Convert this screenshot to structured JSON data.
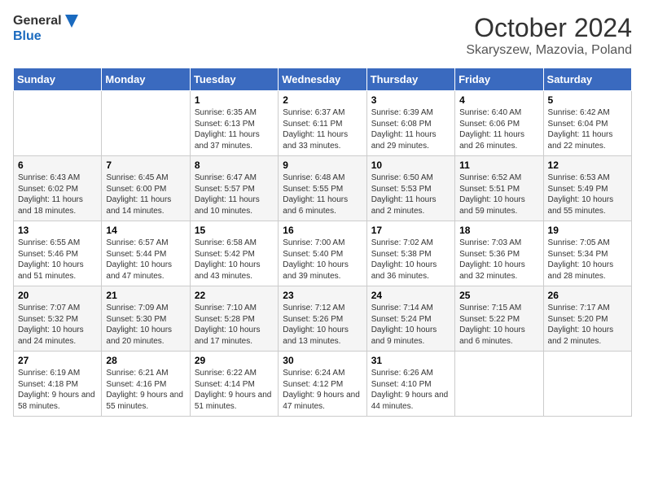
{
  "header": {
    "logo_general": "General",
    "logo_blue": "Blue",
    "month_title": "October 2024",
    "location": "Skaryszew, Mazovia, Poland"
  },
  "weekdays": [
    "Sunday",
    "Monday",
    "Tuesday",
    "Wednesday",
    "Thursday",
    "Friday",
    "Saturday"
  ],
  "weeks": [
    [
      {
        "day": "",
        "sunrise": "",
        "sunset": "",
        "daylight": ""
      },
      {
        "day": "",
        "sunrise": "",
        "sunset": "",
        "daylight": ""
      },
      {
        "day": "1",
        "sunrise": "Sunrise: 6:35 AM",
        "sunset": "Sunset: 6:13 PM",
        "daylight": "Daylight: 11 hours and 37 minutes."
      },
      {
        "day": "2",
        "sunrise": "Sunrise: 6:37 AM",
        "sunset": "Sunset: 6:11 PM",
        "daylight": "Daylight: 11 hours and 33 minutes."
      },
      {
        "day": "3",
        "sunrise": "Sunrise: 6:39 AM",
        "sunset": "Sunset: 6:08 PM",
        "daylight": "Daylight: 11 hours and 29 minutes."
      },
      {
        "day": "4",
        "sunrise": "Sunrise: 6:40 AM",
        "sunset": "Sunset: 6:06 PM",
        "daylight": "Daylight: 11 hours and 26 minutes."
      },
      {
        "day": "5",
        "sunrise": "Sunrise: 6:42 AM",
        "sunset": "Sunset: 6:04 PM",
        "daylight": "Daylight: 11 hours and 22 minutes."
      }
    ],
    [
      {
        "day": "6",
        "sunrise": "Sunrise: 6:43 AM",
        "sunset": "Sunset: 6:02 PM",
        "daylight": "Daylight: 11 hours and 18 minutes."
      },
      {
        "day": "7",
        "sunrise": "Sunrise: 6:45 AM",
        "sunset": "Sunset: 6:00 PM",
        "daylight": "Daylight: 11 hours and 14 minutes."
      },
      {
        "day": "8",
        "sunrise": "Sunrise: 6:47 AM",
        "sunset": "Sunset: 5:57 PM",
        "daylight": "Daylight: 11 hours and 10 minutes."
      },
      {
        "day": "9",
        "sunrise": "Sunrise: 6:48 AM",
        "sunset": "Sunset: 5:55 PM",
        "daylight": "Daylight: 11 hours and 6 minutes."
      },
      {
        "day": "10",
        "sunrise": "Sunrise: 6:50 AM",
        "sunset": "Sunset: 5:53 PM",
        "daylight": "Daylight: 11 hours and 2 minutes."
      },
      {
        "day": "11",
        "sunrise": "Sunrise: 6:52 AM",
        "sunset": "Sunset: 5:51 PM",
        "daylight": "Daylight: 10 hours and 59 minutes."
      },
      {
        "day": "12",
        "sunrise": "Sunrise: 6:53 AM",
        "sunset": "Sunset: 5:49 PM",
        "daylight": "Daylight: 10 hours and 55 minutes."
      }
    ],
    [
      {
        "day": "13",
        "sunrise": "Sunrise: 6:55 AM",
        "sunset": "Sunset: 5:46 PM",
        "daylight": "Daylight: 10 hours and 51 minutes."
      },
      {
        "day": "14",
        "sunrise": "Sunrise: 6:57 AM",
        "sunset": "Sunset: 5:44 PM",
        "daylight": "Daylight: 10 hours and 47 minutes."
      },
      {
        "day": "15",
        "sunrise": "Sunrise: 6:58 AM",
        "sunset": "Sunset: 5:42 PM",
        "daylight": "Daylight: 10 hours and 43 minutes."
      },
      {
        "day": "16",
        "sunrise": "Sunrise: 7:00 AM",
        "sunset": "Sunset: 5:40 PM",
        "daylight": "Daylight: 10 hours and 39 minutes."
      },
      {
        "day": "17",
        "sunrise": "Sunrise: 7:02 AM",
        "sunset": "Sunset: 5:38 PM",
        "daylight": "Daylight: 10 hours and 36 minutes."
      },
      {
        "day": "18",
        "sunrise": "Sunrise: 7:03 AM",
        "sunset": "Sunset: 5:36 PM",
        "daylight": "Daylight: 10 hours and 32 minutes."
      },
      {
        "day": "19",
        "sunrise": "Sunrise: 7:05 AM",
        "sunset": "Sunset: 5:34 PM",
        "daylight": "Daylight: 10 hours and 28 minutes."
      }
    ],
    [
      {
        "day": "20",
        "sunrise": "Sunrise: 7:07 AM",
        "sunset": "Sunset: 5:32 PM",
        "daylight": "Daylight: 10 hours and 24 minutes."
      },
      {
        "day": "21",
        "sunrise": "Sunrise: 7:09 AM",
        "sunset": "Sunset: 5:30 PM",
        "daylight": "Daylight: 10 hours and 20 minutes."
      },
      {
        "day": "22",
        "sunrise": "Sunrise: 7:10 AM",
        "sunset": "Sunset: 5:28 PM",
        "daylight": "Daylight: 10 hours and 17 minutes."
      },
      {
        "day": "23",
        "sunrise": "Sunrise: 7:12 AM",
        "sunset": "Sunset: 5:26 PM",
        "daylight": "Daylight: 10 hours and 13 minutes."
      },
      {
        "day": "24",
        "sunrise": "Sunrise: 7:14 AM",
        "sunset": "Sunset: 5:24 PM",
        "daylight": "Daylight: 10 hours and 9 minutes."
      },
      {
        "day": "25",
        "sunrise": "Sunrise: 7:15 AM",
        "sunset": "Sunset: 5:22 PM",
        "daylight": "Daylight: 10 hours and 6 minutes."
      },
      {
        "day": "26",
        "sunrise": "Sunrise: 7:17 AM",
        "sunset": "Sunset: 5:20 PM",
        "daylight": "Daylight: 10 hours and 2 minutes."
      }
    ],
    [
      {
        "day": "27",
        "sunrise": "Sunrise: 6:19 AM",
        "sunset": "Sunset: 4:18 PM",
        "daylight": "Daylight: 9 hours and 58 minutes."
      },
      {
        "day": "28",
        "sunrise": "Sunrise: 6:21 AM",
        "sunset": "Sunset: 4:16 PM",
        "daylight": "Daylight: 9 hours and 55 minutes."
      },
      {
        "day": "29",
        "sunrise": "Sunrise: 6:22 AM",
        "sunset": "Sunset: 4:14 PM",
        "daylight": "Daylight: 9 hours and 51 minutes."
      },
      {
        "day": "30",
        "sunrise": "Sunrise: 6:24 AM",
        "sunset": "Sunset: 4:12 PM",
        "daylight": "Daylight: 9 hours and 47 minutes."
      },
      {
        "day": "31",
        "sunrise": "Sunrise: 6:26 AM",
        "sunset": "Sunset: 4:10 PM",
        "daylight": "Daylight: 9 hours and 44 minutes."
      },
      {
        "day": "",
        "sunrise": "",
        "sunset": "",
        "daylight": ""
      },
      {
        "day": "",
        "sunrise": "",
        "sunset": "",
        "daylight": ""
      }
    ]
  ]
}
